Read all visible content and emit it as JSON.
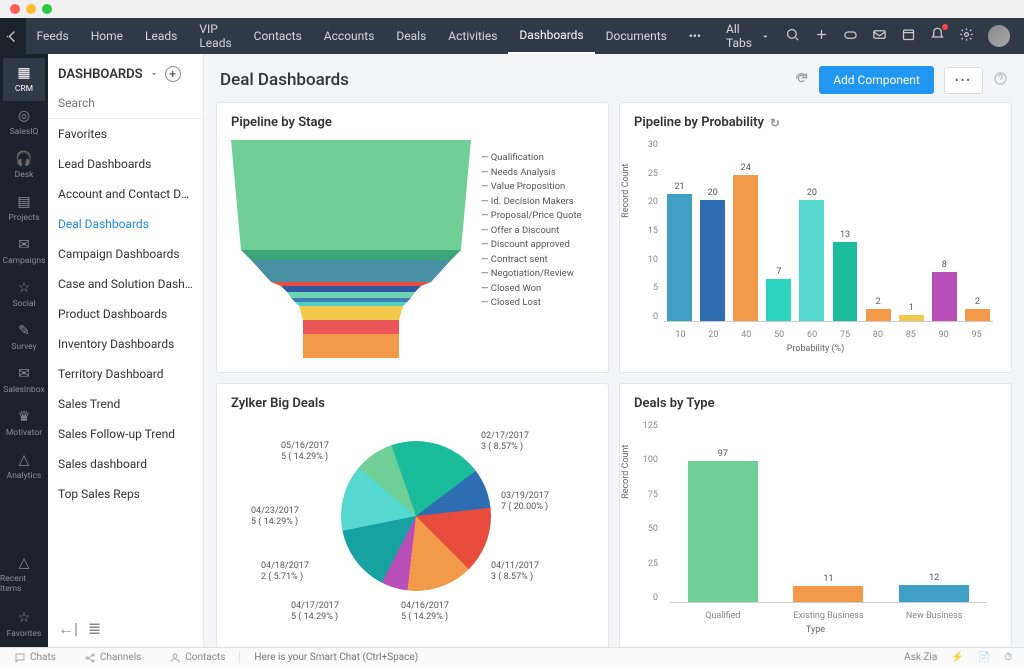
{
  "topnav": {
    "items": [
      "Feeds",
      "Home",
      "Leads",
      "VIP Leads",
      "Contacts",
      "Accounts",
      "Deals",
      "Activities",
      "Dashboards",
      "Documents"
    ],
    "active_index": 8,
    "all_tabs": "All Tabs"
  },
  "rail": {
    "items": [
      "CRM",
      "SalesIQ",
      "Desk",
      "Projects",
      "Campaigns",
      "Social",
      "Survey",
      "SalesInbox",
      "Motivator",
      "Analytics"
    ],
    "active_index": 0,
    "footer": [
      "Recent Items",
      "Favorites"
    ]
  },
  "sidebar": {
    "title": "DASHBOARDS",
    "search_placeholder": "Search",
    "items": [
      "Favorites",
      "Lead Dashboards",
      "Account and Contact Da...",
      "Deal Dashboards",
      "Campaign Dashboards",
      "Case and Solution Dash...",
      "Product Dashboards",
      "Inventory Dashboards",
      "Territory Dashboard",
      "Sales Trend",
      "Sales Follow-up Trend",
      "Sales dashboard",
      "Top Sales Reps"
    ],
    "active_index": 3
  },
  "page": {
    "title": "Deal Dashboards",
    "add_component": "Add Component"
  },
  "panel1": {
    "title": "Pipeline by Stage",
    "legend": [
      "Qualification",
      "Needs Analysis",
      "Value Proposition",
      "Id. Decision Makers",
      "Proposal/Price Quote",
      "Offer a Discount",
      "Discount approved",
      "Contract sent",
      "Negotiation/Review",
      "Closed Won",
      "Closed Lost"
    ]
  },
  "panel2": {
    "title": "Pipeline by Probability",
    "ylabel": "Record Count",
    "xlabel": "Probability (%)"
  },
  "panel3": {
    "title": "Zylker Big Deals"
  },
  "panel4": {
    "title": "Deals by Type",
    "ylabel": "Record Count",
    "xlabel": "Type"
  },
  "bottombar": {
    "items": [
      "Chats",
      "Channels",
      "Contacts"
    ],
    "placeholder": "Here is your Smart Chat (Ctrl+Space)",
    "ask": "Ask Zia"
  },
  "chart_data": [
    {
      "id": "pipeline_by_stage",
      "type": "funnel",
      "categories": [
        "Qualification",
        "Needs Analysis",
        "Value Proposition",
        "Id. Decision Makers",
        "Proposal/Price Quote",
        "Offer a Discount",
        "Discount approved",
        "Contract sent",
        "Negotiation/Review",
        "Closed Won",
        "Closed Lost"
      ],
      "colors": [
        "#6fcf97",
        "#3da57a",
        "#4a90a4",
        "#e74c3c",
        "#2d5aa0",
        "#6dd3b3",
        "#3e7cb1",
        "#4fd1c5",
        "#f2c94c",
        "#eb5757",
        "#f2994a"
      ]
    },
    {
      "id": "pipeline_by_probability",
      "type": "bar",
      "xlabel": "Probability (%)",
      "ylabel": "Record Count",
      "ylim": [
        0,
        30
      ],
      "yticks": [
        0,
        5,
        10,
        15,
        20,
        25,
        30
      ],
      "categories": [
        "10",
        "20",
        "40",
        "50",
        "60",
        "75",
        "80",
        "85",
        "90",
        "95"
      ],
      "values": [
        21,
        20,
        24,
        7,
        20,
        13,
        2,
        1,
        8,
        2
      ],
      "colors": [
        "#3f9fc5",
        "#2f6db3",
        "#f2994a",
        "#2dd4bf",
        "#55d8d0",
        "#1abc9c",
        "#f2994a",
        "#f2c94c",
        "#b84fb8",
        "#f2994a"
      ]
    },
    {
      "id": "zylker_big_deals",
      "type": "pie",
      "slices": [
        {
          "label": "02/17/2017",
          "count": 3,
          "pct": 8.57,
          "color": "#6fcf97"
        },
        {
          "label": "03/19/2017",
          "count": 7,
          "pct": 20.0,
          "color": "#1abc9c"
        },
        {
          "label": "04/11/2017",
          "count": 3,
          "pct": 8.57,
          "color": "#2f6db3"
        },
        {
          "label": "04/16/2017",
          "count": 5,
          "pct": 14.29,
          "color": "#e74c3c"
        },
        {
          "label": "04/17/2017",
          "count": 5,
          "pct": 14.29,
          "color": "#f2994a"
        },
        {
          "label": "04/18/2017",
          "count": 2,
          "pct": 5.71,
          "color": "#b84fb8"
        },
        {
          "label": "04/23/2017",
          "count": 5,
          "pct": 14.29,
          "color": "#17a2a2"
        },
        {
          "label": "05/16/2017",
          "count": 5,
          "pct": 14.29,
          "color": "#55d8d0"
        }
      ]
    },
    {
      "id": "deals_by_type",
      "type": "bar",
      "xlabel": "Type",
      "ylabel": "Record Count",
      "ylim": [
        0,
        125
      ],
      "yticks": [
        0,
        25,
        50,
        75,
        100,
        125
      ],
      "categories": [
        "Qualified",
        "Existing Business",
        "New Business"
      ],
      "values": [
        97,
        11,
        12
      ],
      "colors": [
        "#6fcf97",
        "#f2994a",
        "#3f9fc5"
      ]
    }
  ]
}
